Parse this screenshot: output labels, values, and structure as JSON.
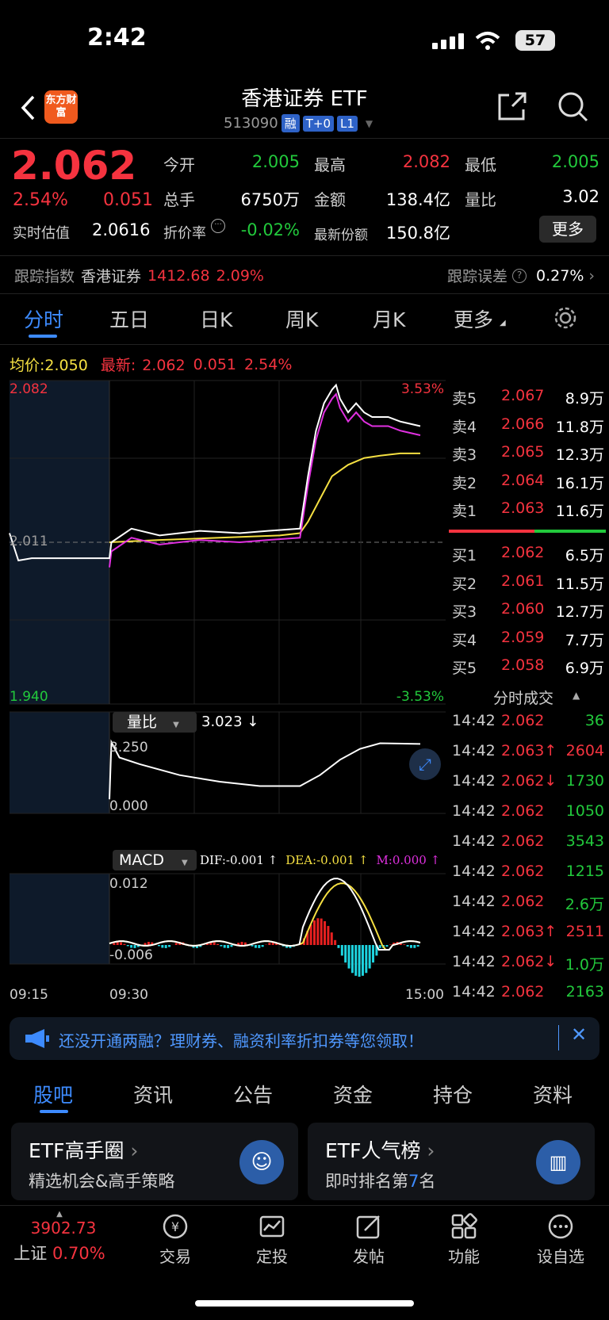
{
  "status": {
    "time": "2:42",
    "battery": "57"
  },
  "header": {
    "title": "香港证券 ETF",
    "code": "513090",
    "tags": [
      "融",
      "T+0",
      "L1"
    ],
    "logo_text": "东方财富"
  },
  "quote": {
    "price": "2.062",
    "change_pct": "2.54%",
    "change": "0.051",
    "est_label": "实时估值",
    "est_value": "2.0616",
    "open_label": "今开",
    "open": "2.005",
    "high_label": "最高",
    "high": "2.082",
    "low_label": "最低",
    "low": "2.005",
    "vol_label": "总手",
    "vol": "6750万",
    "amt_label": "金额",
    "amt": "138.4亿",
    "ratio_label": "量比",
    "ratio": "3.02",
    "disc_label": "折价率",
    "disc": "-0.02%",
    "share_label": "最新份额",
    "share": "150.8亿",
    "more_btn": "更多"
  },
  "track": {
    "label": "跟踪指数",
    "index": "香港证券",
    "value": "1412.68",
    "pct": "2.09%",
    "err_label": "跟踪误差",
    "err": "0.27%"
  },
  "tabs": [
    "分时",
    "五日",
    "日K",
    "周K",
    "月K",
    "更多"
  ],
  "chart_header": {
    "avg_label": "均价:",
    "avg": "2.050",
    "latest_label": "最新:",
    "latest": "2.062",
    "chg": "0.051",
    "pct": "2.54%"
  },
  "chart_data": [
    {
      "type": "line",
      "title": "",
      "y_labels": {
        "top": "2.082",
        "mid": "2.011",
        "bottom": "1.940",
        "top_pct": "3.53%",
        "bottom_pct": "-3.53%"
      },
      "x_labels": [
        "09:15",
        "09:30",
        "15:00"
      ],
      "ylim": [
        1.94,
        2.082
      ],
      "series": [
        {
          "name": "",
          "color": "#ffffff",
          "x": [
            0,
            0.02,
            0.05,
            0.1,
            0.18,
            0.225,
            0.23,
            0.28,
            0.35,
            0.45,
            0.55,
            0.62,
            0.7,
            0.72,
            0.74,
            0.76,
            0.78,
            0.79,
            0.8,
            0.82,
            0.84,
            0.86,
            0.88,
            0.92,
            0.95,
            1
          ],
          "y": [
            2.015,
            2.003,
            2.004,
            2.004,
            2.004,
            2.004,
            2.011,
            2.017,
            2.014,
            2.016,
            2.015,
            2.016,
            2.017,
            2.04,
            2.06,
            2.072,
            2.078,
            2.08,
            2.074,
            2.068,
            2.072,
            2.068,
            2.066,
            2.066,
            2.064,
            2.062
          ]
        },
        {
          "name": "",
          "color": "#f5e042",
          "x": [
            0.225,
            0.35,
            0.5,
            0.65,
            0.7,
            0.72,
            0.75,
            0.78,
            0.82,
            0.86,
            0.9,
            0.95,
            1
          ],
          "y": [
            2.011,
            2.012,
            2.013,
            2.014,
            2.015,
            2.02,
            2.03,
            2.04,
            2.045,
            2.048,
            2.049,
            2.05,
            2.05
          ]
        }
      ]
    },
    {
      "type": "line",
      "title": "",
      "indicator": "量比",
      "indicator_value": "3.023 ↓",
      "y_labels": {
        "top": "3.250",
        "bottom": "0.000"
      },
      "ylim": [
        0,
        3.25
      ],
      "series": [
        {
          "name": "",
          "color": "#ffffff",
          "x": [
            0.225,
            0.23,
            0.25,
            0.3,
            0.4,
            0.5,
            0.6,
            0.7,
            0.75,
            0.8,
            0.85,
            0.9,
            1
          ],
          "y": [
            0.5,
            3.1,
            2.4,
            2.1,
            1.6,
            1.3,
            1.1,
            1.1,
            1.6,
            2.3,
            2.8,
            3.05,
            3.02
          ]
        }
      ]
    },
    {
      "type": "bar",
      "title": "",
      "indicator": "MACD",
      "legend": {
        "dif": "DIF:-0.001 ↑",
        "dea": "DEA:-0.001 ↑",
        "m": "M:0.000 ↑"
      },
      "y_labels": {
        "top": "0.012",
        "bottom": "-0.006"
      },
      "ylim": [
        -0.006,
        0.012
      ]
    }
  ],
  "orderbook": {
    "asks": [
      {
        "label": "卖5",
        "price": "2.067",
        "vol": "8.9万"
      },
      {
        "label": "卖4",
        "price": "2.066",
        "vol": "11.8万"
      },
      {
        "label": "卖3",
        "price": "2.065",
        "vol": "12.3万"
      },
      {
        "label": "卖2",
        "price": "2.064",
        "vol": "16.1万"
      },
      {
        "label": "卖1",
        "price": "2.063",
        "vol": "11.6万"
      }
    ],
    "bids": [
      {
        "label": "买1",
        "price": "2.062",
        "vol": "6.5万"
      },
      {
        "label": "买2",
        "price": "2.061",
        "vol": "11.5万"
      },
      {
        "label": "买3",
        "price": "2.060",
        "vol": "12.7万"
      },
      {
        "label": "买4",
        "price": "2.059",
        "vol": "7.7万"
      },
      {
        "label": "买5",
        "price": "2.058",
        "vol": "6.9万"
      }
    ]
  },
  "trades_title": "分时成交",
  "trades": [
    {
      "time": "14:42",
      "price": "2.062",
      "vol": "36",
      "pc": "red",
      "vc": "green"
    },
    {
      "time": "14:42",
      "price": "2.063↑",
      "vol": "2604",
      "pc": "red",
      "vc": "red"
    },
    {
      "time": "14:42",
      "price": "2.062↓",
      "vol": "1730",
      "pc": "red",
      "vc": "green"
    },
    {
      "time": "14:42",
      "price": "2.062",
      "vol": "1050",
      "pc": "red",
      "vc": "green"
    },
    {
      "time": "14:42",
      "price": "2.062",
      "vol": "3543",
      "pc": "red",
      "vc": "green"
    },
    {
      "time": "14:42",
      "price": "2.062",
      "vol": "1215",
      "pc": "red",
      "vc": "green"
    },
    {
      "time": "14:42",
      "price": "2.062",
      "vol": "2.6万",
      "pc": "red",
      "vc": "green"
    },
    {
      "time": "14:42",
      "price": "2.063↑",
      "vol": "2511",
      "pc": "red",
      "vc": "red"
    },
    {
      "time": "14:42",
      "price": "2.062↓",
      "vol": "1.0万",
      "pc": "red",
      "vc": "green"
    },
    {
      "time": "14:42",
      "price": "2.062",
      "vol": "2163",
      "pc": "red",
      "vc": "green"
    }
  ],
  "banner": {
    "text": "还没开通两融？理财券、融资利率折扣券等您领取！"
  },
  "bottom_tabs": [
    "股吧",
    "资讯",
    "公告",
    "资金",
    "持仓",
    "资料"
  ],
  "cards": [
    {
      "title": "ETF高手圈",
      "sub": "精选机会&高手策略"
    },
    {
      "title": "ETF人气榜",
      "sub_pre": "即时排名第",
      "rank": "7",
      "sub_post": "名"
    }
  ],
  "nav": {
    "index_value": "3902.73",
    "index_name": "上证",
    "index_pct": "0.70%",
    "items": [
      "交易",
      "定投",
      "发帖",
      "功能",
      "设自选"
    ]
  }
}
